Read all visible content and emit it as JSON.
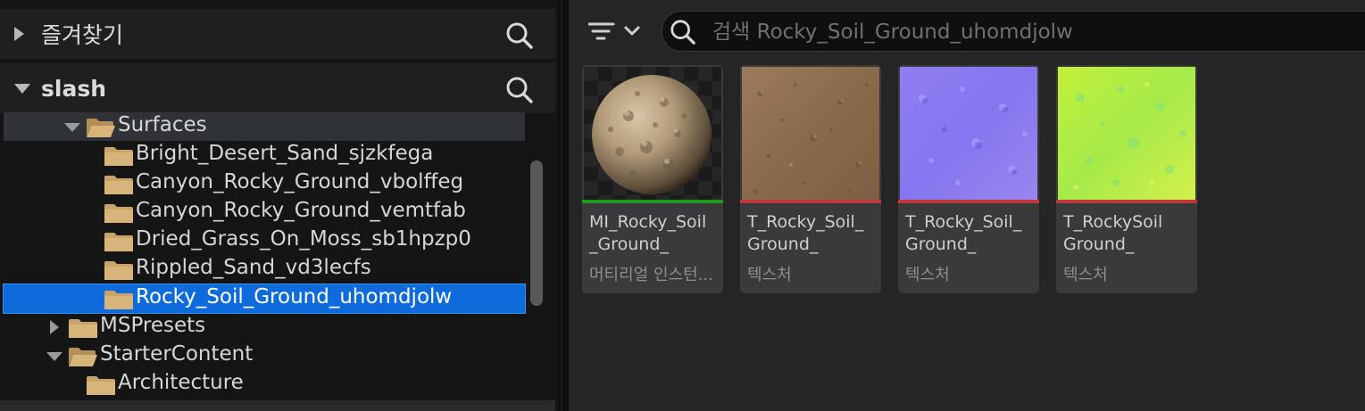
{
  "left_panel": {
    "favorites": {
      "title": "즐겨찾기"
    },
    "project": {
      "title": "slash"
    },
    "tree": [
      {
        "label": "Surfaces"
      },
      {
        "label": "Bright_Desert_Sand_sjzkfega"
      },
      {
        "label": "Canyon_Rocky_Ground_vbolffeg"
      },
      {
        "label": "Canyon_Rocky_Ground_vemtfab"
      },
      {
        "label": "Dried_Grass_On_Moss_sb1hpzp0"
      },
      {
        "label": "Rippled_Sand_vd3lecfs"
      },
      {
        "label": "Rocky_Soil_Ground_uhomdjolw"
      },
      {
        "label": "MSPresets"
      },
      {
        "label": "StarterContent"
      },
      {
        "label": "Architecture"
      }
    ]
  },
  "right_panel": {
    "search": {
      "placeholder": "검색 Rocky_Soil_Ground_uhomdjolw",
      "value": ""
    },
    "assets": [
      {
        "name": "MI_Rocky_Soil _Ground_",
        "type": "머티리얼 인스턴...",
        "type_color": "#1e9b1e"
      },
      {
        "name": "T_Rocky_Soil_ Ground_",
        "type": "텍스처",
        "type_color": "#c0383c"
      },
      {
        "name": "T_Rocky_Soil_ Ground_",
        "type": "텍스처",
        "type_color": "#c0383c"
      },
      {
        "name": "T_RockySoil Ground_",
        "type": "텍스처",
        "type_color": "#c0383c"
      }
    ]
  },
  "colors": {
    "selection": "#0f6bdc",
    "folder": "#c9a36a",
    "material_accent": "#1e9b1e",
    "texture_accent": "#c0383c"
  },
  "icons": [
    "expand-arrow-icon",
    "search-icon",
    "folder-icon",
    "folder-open-icon",
    "filter-icon",
    "chevron-down-icon"
  ]
}
